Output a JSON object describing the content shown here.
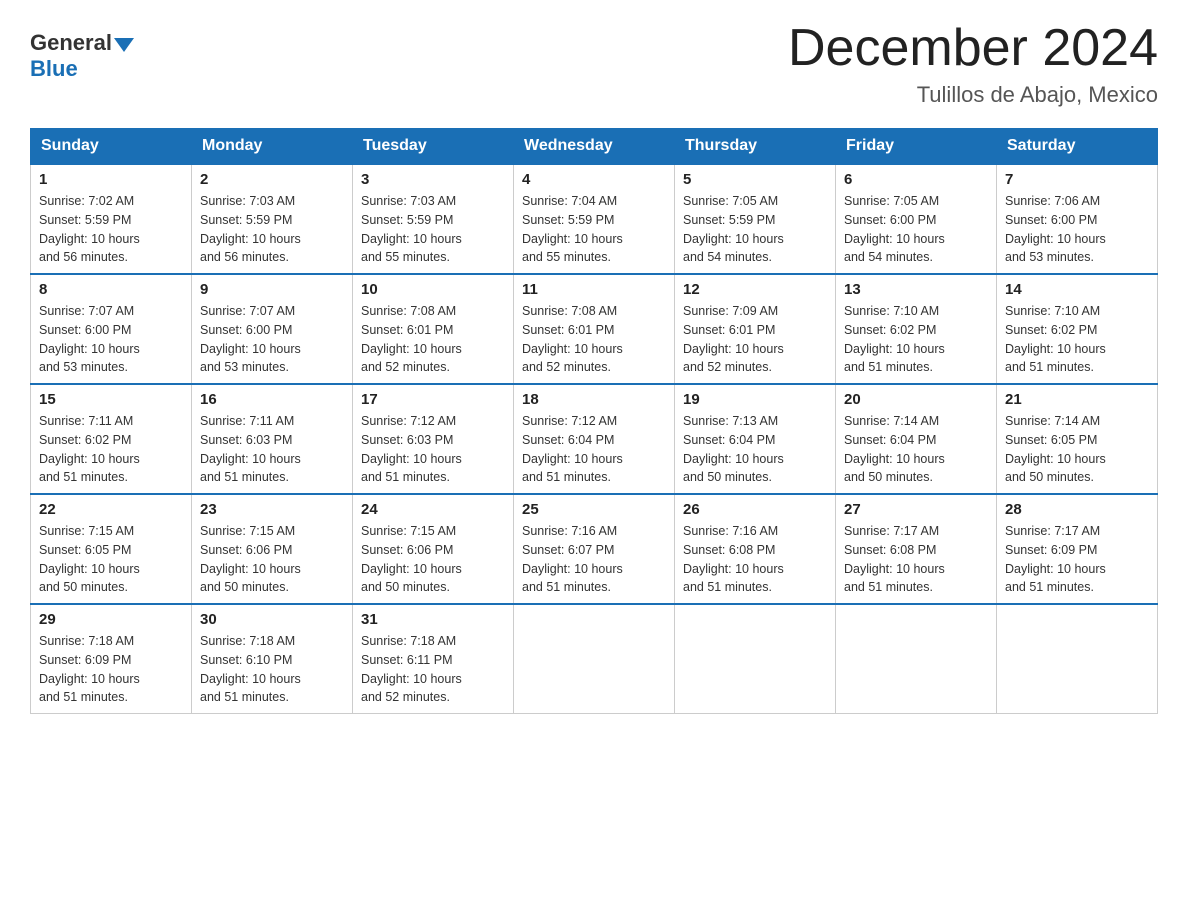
{
  "header": {
    "logo_general": "General",
    "logo_blue": "Blue",
    "month_title": "December 2024",
    "location": "Tulillos de Abajo, Mexico"
  },
  "weekdays": [
    "Sunday",
    "Monday",
    "Tuesday",
    "Wednesday",
    "Thursday",
    "Friday",
    "Saturday"
  ],
  "weeks": [
    [
      {
        "day": "1",
        "sunrise": "7:02 AM",
        "sunset": "5:59 PM",
        "daylight": "10 hours and 56 minutes."
      },
      {
        "day": "2",
        "sunrise": "7:03 AM",
        "sunset": "5:59 PM",
        "daylight": "10 hours and 56 minutes."
      },
      {
        "day": "3",
        "sunrise": "7:03 AM",
        "sunset": "5:59 PM",
        "daylight": "10 hours and 55 minutes."
      },
      {
        "day": "4",
        "sunrise": "7:04 AM",
        "sunset": "5:59 PM",
        "daylight": "10 hours and 55 minutes."
      },
      {
        "day": "5",
        "sunrise": "7:05 AM",
        "sunset": "5:59 PM",
        "daylight": "10 hours and 54 minutes."
      },
      {
        "day": "6",
        "sunrise": "7:05 AM",
        "sunset": "6:00 PM",
        "daylight": "10 hours and 54 minutes."
      },
      {
        "day": "7",
        "sunrise": "7:06 AM",
        "sunset": "6:00 PM",
        "daylight": "10 hours and 53 minutes."
      }
    ],
    [
      {
        "day": "8",
        "sunrise": "7:07 AM",
        "sunset": "6:00 PM",
        "daylight": "10 hours and 53 minutes."
      },
      {
        "day": "9",
        "sunrise": "7:07 AM",
        "sunset": "6:00 PM",
        "daylight": "10 hours and 53 minutes."
      },
      {
        "day": "10",
        "sunrise": "7:08 AM",
        "sunset": "6:01 PM",
        "daylight": "10 hours and 52 minutes."
      },
      {
        "day": "11",
        "sunrise": "7:08 AM",
        "sunset": "6:01 PM",
        "daylight": "10 hours and 52 minutes."
      },
      {
        "day": "12",
        "sunrise": "7:09 AM",
        "sunset": "6:01 PM",
        "daylight": "10 hours and 52 minutes."
      },
      {
        "day": "13",
        "sunrise": "7:10 AM",
        "sunset": "6:02 PM",
        "daylight": "10 hours and 51 minutes."
      },
      {
        "day": "14",
        "sunrise": "7:10 AM",
        "sunset": "6:02 PM",
        "daylight": "10 hours and 51 minutes."
      }
    ],
    [
      {
        "day": "15",
        "sunrise": "7:11 AM",
        "sunset": "6:02 PM",
        "daylight": "10 hours and 51 minutes."
      },
      {
        "day": "16",
        "sunrise": "7:11 AM",
        "sunset": "6:03 PM",
        "daylight": "10 hours and 51 minutes."
      },
      {
        "day": "17",
        "sunrise": "7:12 AM",
        "sunset": "6:03 PM",
        "daylight": "10 hours and 51 minutes."
      },
      {
        "day": "18",
        "sunrise": "7:12 AM",
        "sunset": "6:04 PM",
        "daylight": "10 hours and 51 minutes."
      },
      {
        "day": "19",
        "sunrise": "7:13 AM",
        "sunset": "6:04 PM",
        "daylight": "10 hours and 50 minutes."
      },
      {
        "day": "20",
        "sunrise": "7:14 AM",
        "sunset": "6:04 PM",
        "daylight": "10 hours and 50 minutes."
      },
      {
        "day": "21",
        "sunrise": "7:14 AM",
        "sunset": "6:05 PM",
        "daylight": "10 hours and 50 minutes."
      }
    ],
    [
      {
        "day": "22",
        "sunrise": "7:15 AM",
        "sunset": "6:05 PM",
        "daylight": "10 hours and 50 minutes."
      },
      {
        "day": "23",
        "sunrise": "7:15 AM",
        "sunset": "6:06 PM",
        "daylight": "10 hours and 50 minutes."
      },
      {
        "day": "24",
        "sunrise": "7:15 AM",
        "sunset": "6:06 PM",
        "daylight": "10 hours and 50 minutes."
      },
      {
        "day": "25",
        "sunrise": "7:16 AM",
        "sunset": "6:07 PM",
        "daylight": "10 hours and 51 minutes."
      },
      {
        "day": "26",
        "sunrise": "7:16 AM",
        "sunset": "6:08 PM",
        "daylight": "10 hours and 51 minutes."
      },
      {
        "day": "27",
        "sunrise": "7:17 AM",
        "sunset": "6:08 PM",
        "daylight": "10 hours and 51 minutes."
      },
      {
        "day": "28",
        "sunrise": "7:17 AM",
        "sunset": "6:09 PM",
        "daylight": "10 hours and 51 minutes."
      }
    ],
    [
      {
        "day": "29",
        "sunrise": "7:18 AM",
        "sunset": "6:09 PM",
        "daylight": "10 hours and 51 minutes."
      },
      {
        "day": "30",
        "sunrise": "7:18 AM",
        "sunset": "6:10 PM",
        "daylight": "10 hours and 51 minutes."
      },
      {
        "day": "31",
        "sunrise": "7:18 AM",
        "sunset": "6:11 PM",
        "daylight": "10 hours and 52 minutes."
      },
      null,
      null,
      null,
      null
    ]
  ],
  "labels": {
    "sunrise": "Sunrise:",
    "sunset": "Sunset:",
    "daylight": "Daylight:"
  }
}
